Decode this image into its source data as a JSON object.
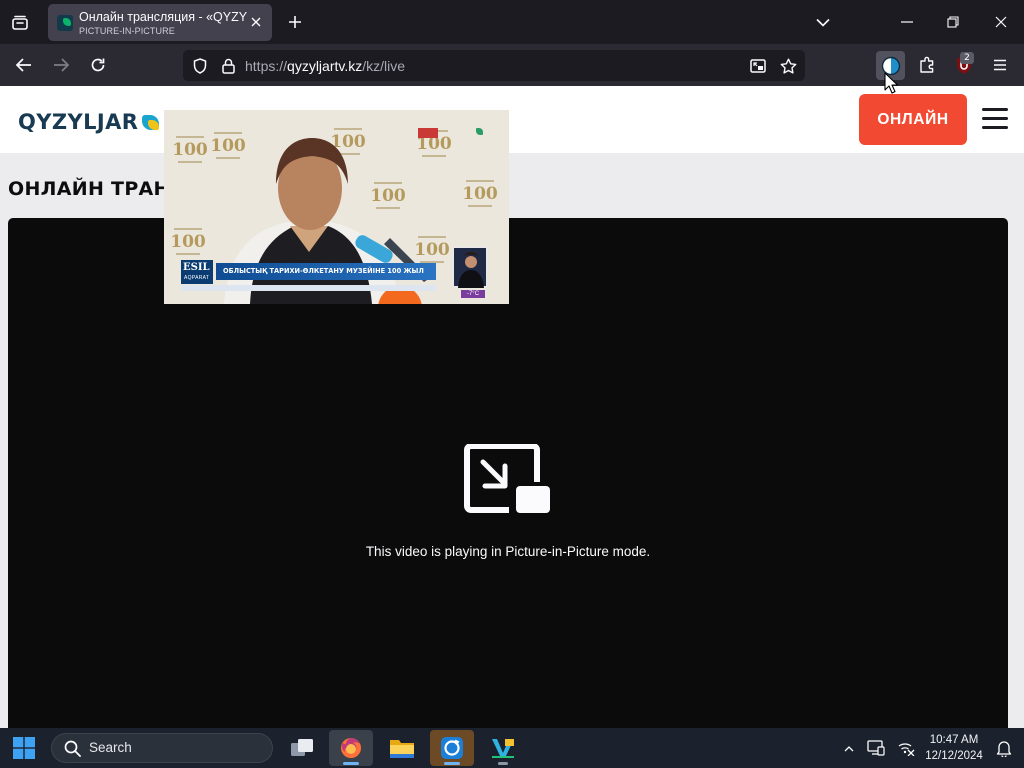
{
  "browser": {
    "tab": {
      "title": "Онлайн трансляция - «QYZYLJAR»",
      "subtitle": "PICTURE-IN-PICTURE"
    },
    "url": {
      "prefix": "https://",
      "host": "qyzyljartv.kz",
      "path": "/kz/live"
    },
    "extensions": {
      "ublock_badge": "2"
    }
  },
  "site": {
    "logo_text": "QYZYLJAR",
    "online_button": "ОНЛАЙН",
    "page_title": "ОНЛАЙН ТРАНСЛЯЦИЯ"
  },
  "player": {
    "pip_message": "This video is playing in Picture-in-Picture mode."
  },
  "pip_video": {
    "channel_name": "ESIL",
    "channel_sub": "AQPARAT",
    "caption": "ОБЛЫСТЫҚ ТАРИХИ-ӨЛКЕТАНУ МУЗЕЙІНЕ 100 ЖЫЛ",
    "wall_number": "100",
    "temperature": "-7°C"
  },
  "taskbar": {
    "search_label": "Search",
    "clock_time": "10:47 AM",
    "clock_date": "12/12/2024"
  },
  "colors": {
    "online_button": "#f24a32",
    "logo_text": "#183b53",
    "player_bg": "#0b0b0c",
    "taskbar_bg": "#1b222d"
  },
  "icons": [
    "tab-list-icon",
    "close-icon",
    "plus-icon",
    "chevron-down-icon",
    "minimize-icon",
    "restore-icon",
    "back-icon",
    "forward-icon",
    "reload-icon",
    "shield-icon",
    "lock-icon",
    "picture-in-picture-icon",
    "star-icon",
    "dark-reader-icon",
    "puzzle-icon",
    "ublock-icon",
    "hamburger-icon",
    "windows-icon",
    "search-icon",
    "task-view-icon",
    "firefox-icon",
    "file-explorer-icon",
    "sync-app-icon",
    "visual-app-icon",
    "bell-icon"
  ]
}
